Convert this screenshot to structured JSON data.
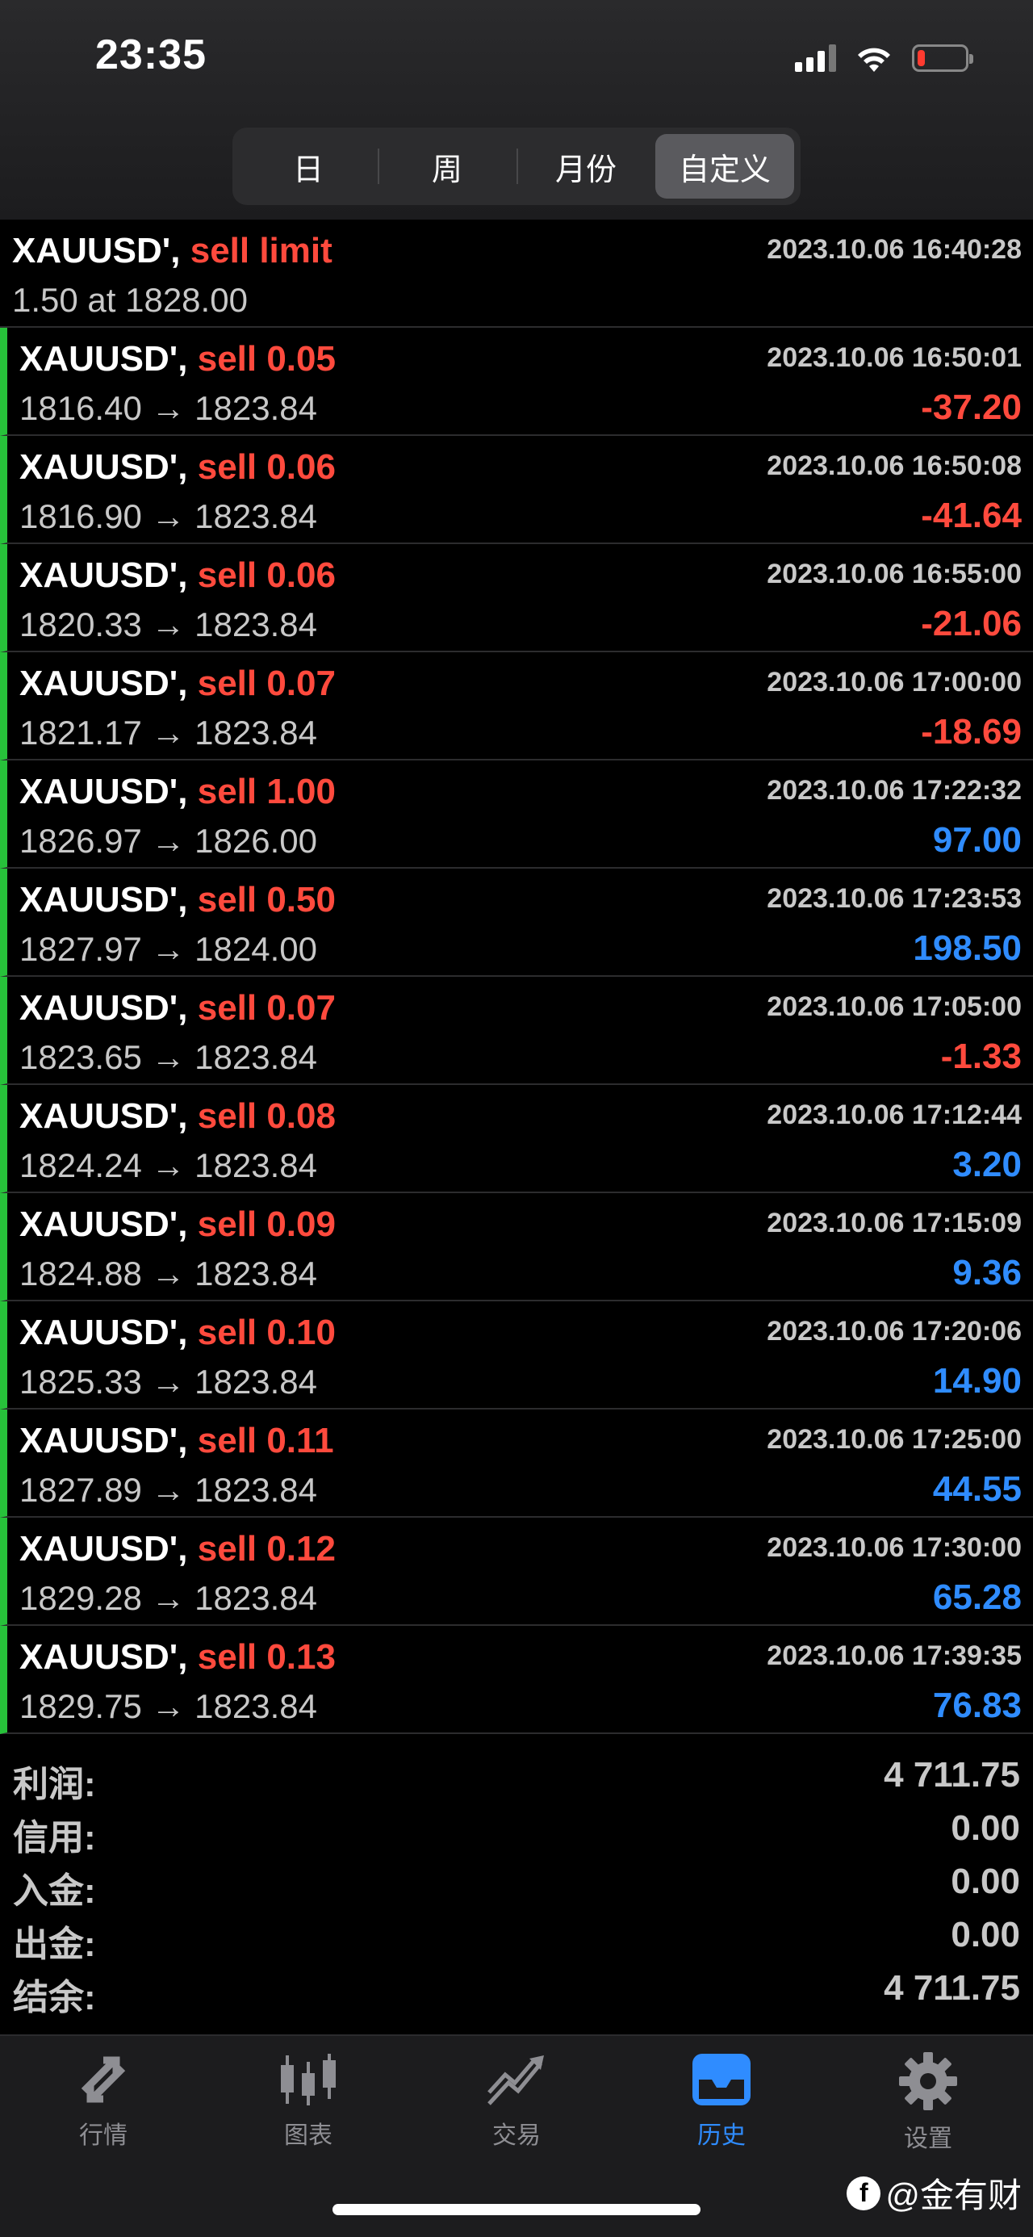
{
  "status": {
    "time": "23:35",
    "battery_level": 0.15
  },
  "tabs_period": [
    {
      "label": "日",
      "active": false
    },
    {
      "label": "周",
      "active": false
    },
    {
      "label": "月份",
      "active": false
    },
    {
      "label": "自定义",
      "active": true
    }
  ],
  "orders": [
    {
      "symbol": "XAUUSD',",
      "action": "sell limit",
      "line2": "1.50 at 1828.00",
      "time": "2023.10.06 16:40:28",
      "profit": ""
    },
    {
      "symbol": "XAUUSD',",
      "action": "sell 0.05",
      "line2": "1816.40 → 1823.84",
      "time": "2023.10.06 16:50:01",
      "profit": "-37.20"
    },
    {
      "symbol": "XAUUSD',",
      "action": "sell 0.06",
      "line2": "1816.90 → 1823.84",
      "time": "2023.10.06 16:50:08",
      "profit": "-41.64"
    },
    {
      "symbol": "XAUUSD',",
      "action": "sell 0.06",
      "line2": "1820.33 → 1823.84",
      "time": "2023.10.06 16:55:00",
      "profit": "-21.06"
    },
    {
      "symbol": "XAUUSD',",
      "action": "sell 0.07",
      "line2": "1821.17 → 1823.84",
      "time": "2023.10.06 17:00:00",
      "profit": "-18.69"
    },
    {
      "symbol": "XAUUSD',",
      "action": "sell 1.00",
      "line2": "1826.97 → 1826.00",
      "time": "2023.10.06 17:22:32",
      "profit": "97.00"
    },
    {
      "symbol": "XAUUSD',",
      "action": "sell 0.50",
      "line2": "1827.97 → 1824.00",
      "time": "2023.10.06 17:23:53",
      "profit": "198.50"
    },
    {
      "symbol": "XAUUSD',",
      "action": "sell 0.07",
      "line2": "1823.65 → 1823.84",
      "time": "2023.10.06 17:05:00",
      "profit": "-1.33"
    },
    {
      "symbol": "XAUUSD',",
      "action": "sell 0.08",
      "line2": "1824.24 → 1823.84",
      "time": "2023.10.06 17:12:44",
      "profit": "3.20"
    },
    {
      "symbol": "XAUUSD',",
      "action": "sell 0.09",
      "line2": "1824.88 → 1823.84",
      "time": "2023.10.06 17:15:09",
      "profit": "9.36"
    },
    {
      "symbol": "XAUUSD',",
      "action": "sell 0.10",
      "line2": "1825.33 → 1823.84",
      "time": "2023.10.06 17:20:06",
      "profit": "14.90"
    },
    {
      "symbol": "XAUUSD',",
      "action": "sell 0.11",
      "line2": "1827.89 → 1823.84",
      "time": "2023.10.06 17:25:00",
      "profit": "44.55"
    },
    {
      "symbol": "XAUUSD',",
      "action": "sell 0.12",
      "line2": "1829.28 → 1823.84",
      "time": "2023.10.06 17:30:00",
      "profit": "65.28"
    },
    {
      "symbol": "XAUUSD',",
      "action": "sell 0.13",
      "line2": "1829.75 → 1823.84",
      "time": "2023.10.06 17:39:35",
      "profit": "76.83"
    }
  ],
  "summary": [
    {
      "label": "利润:",
      "value": "4 711.75"
    },
    {
      "label": "信用:",
      "value": "0.00"
    },
    {
      "label": "入金:",
      "value": "0.00"
    },
    {
      "label": "出金:",
      "value": "0.00"
    },
    {
      "label": "结余:",
      "value": "4 711.75"
    }
  ],
  "tabbar": [
    {
      "label": "行情",
      "icon": "quotes-icon",
      "active": false
    },
    {
      "label": "图表",
      "icon": "chart-icon",
      "active": false
    },
    {
      "label": "交易",
      "icon": "trade-icon",
      "active": false
    },
    {
      "label": "历史",
      "icon": "history-icon",
      "active": true
    },
    {
      "label": "设置",
      "icon": "settings-icon",
      "active": false
    }
  ],
  "watermark": "@金有财",
  "colors": {
    "loss": "#ff4a3d",
    "profit": "#2f8cff",
    "trade_marker": "#27c13a",
    "active_tab": "#2f8cff"
  }
}
